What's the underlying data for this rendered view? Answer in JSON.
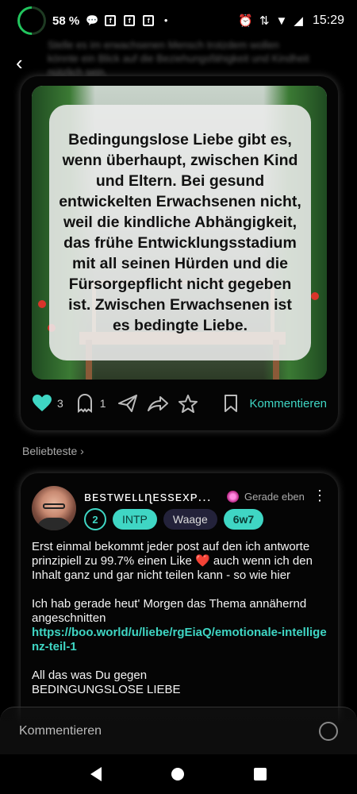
{
  "status_bar": {
    "battery": "58 %",
    "time": "15:29"
  },
  "post": {
    "blurred_text": "Stelle es im erwachsenen Mensch trotzdem wollen könnte ein Blick auf die Beziehungsfähigkeit und Kindheit nützlich sein.",
    "quote": "Bedingungslose Liebe gibt es, wenn überhaupt, zwischen Kind und Eltern. Bei gesund entwickelten Erwachsenen nicht, weil die kindliche Abhängigkeit, das frühe Entwicklungsstadium mit all seinen Hürden und die Fürsorgepflicht nicht gegeben ist. Zwischen Erwachsenen ist es bedingte Liebe.",
    "likes": "3",
    "comments": "1",
    "comment_action": "Kommentieren"
  },
  "sort_label": "Beliebteste",
  "comment": {
    "username": "ʙᴇsᴛᴡᴇʟʟɳᴇssᴇxᴘ...",
    "time": "Gerade eben",
    "badges": {
      "level": "2",
      "mbti": "INTP",
      "zodiac": "Waage",
      "enneagram": "6w7"
    },
    "paragraph1_a": "Erst einmal bekommt jeder post auf den ich antworte prinzipiell zu 99.7% einen Like ",
    "paragraph1_heart": "❤️",
    "paragraph1_b": " auch wenn ich den Inhalt ganz und gar nicht teilen kann - so wie hier",
    "paragraph2": "Ich hab gerade heut' Morgen das Thema annähernd angeschnitten",
    "link": "https://boo.world/u/liebe/rgEiaQ/emotionale-intelligenz-teil-1",
    "paragraph3_line1": "All das was Du gegen",
    "paragraph3_line2": "BEDINGUNGSLOSE LIEBE"
  },
  "composer": {
    "placeholder": "Kommentieren"
  },
  "colors": {
    "accent": "#3fd6c4",
    "battery_ring": "#22c55e"
  }
}
